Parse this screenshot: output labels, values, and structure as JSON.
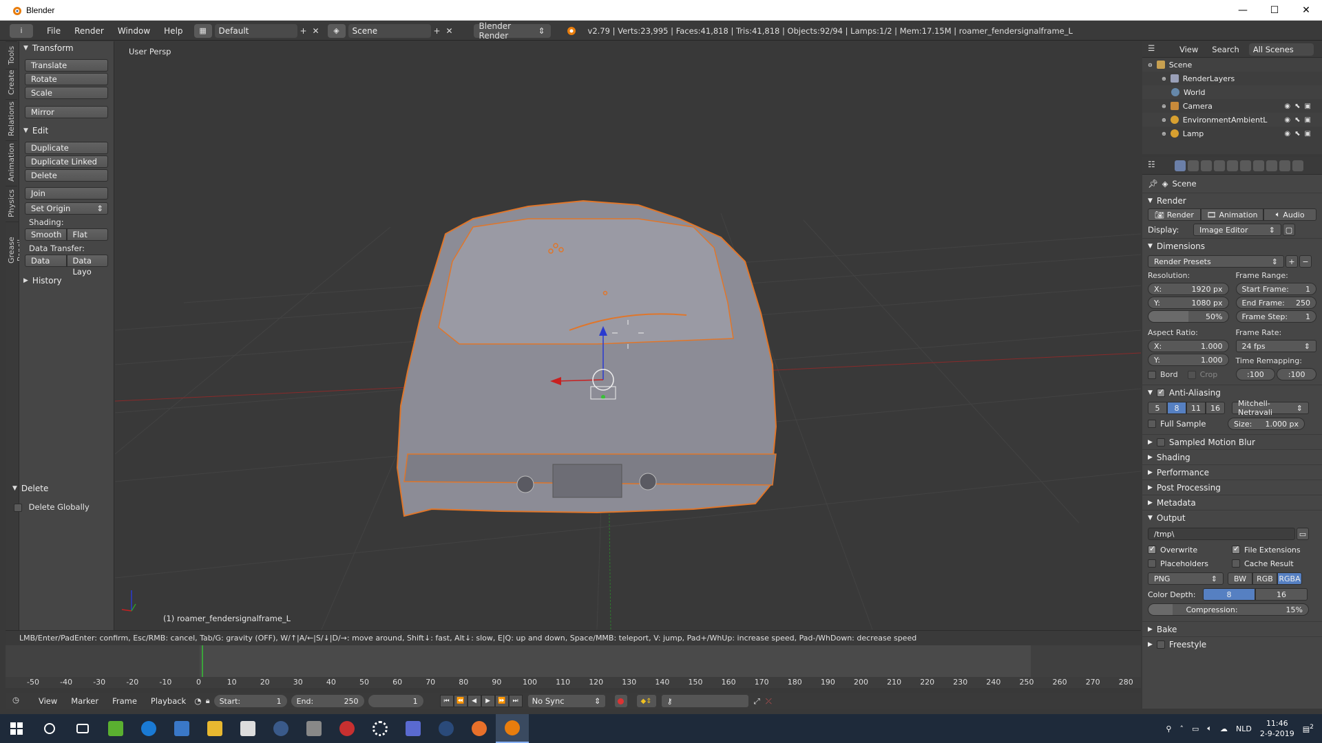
{
  "window": {
    "title": "Blender",
    "minimize": "—",
    "maximize": "☐",
    "close": "✕"
  },
  "info": {
    "editor": "i",
    "menus": [
      "File",
      "Render",
      "Window",
      "Help"
    ],
    "layout": "Default",
    "scene": "Scene",
    "engine": "Blender Render",
    "stats": "v2.79 | Verts:23,995 | Faces:41,818 | Tris:41,818 | Objects:92/94 | Lamps:1/2 | Mem:17.15M | roamer_fendersignalframe_L"
  },
  "tabs": [
    "Tools",
    "Create",
    "Relations",
    "Animation",
    "Physics",
    "Grease Pencil"
  ],
  "tool_shelf": {
    "transform_header": "Transform",
    "translate": "Translate",
    "rotate": "Rotate",
    "scale": "Scale",
    "mirror": "Mirror",
    "edit_header": "Edit",
    "duplicate": "Duplicate",
    "duplicate_linked": "Duplicate Linked",
    "delete": "Delete",
    "join": "Join",
    "set_origin": "Set Origin",
    "shading_label": "Shading:",
    "smooth": "Smooth",
    "flat": "Flat",
    "data_transfer_label": "Data Transfer:",
    "data": "Data",
    "data_layout": "Data Layo",
    "history_header": "History",
    "delete_header": "Delete",
    "delete_globally": "Delete Globally"
  },
  "viewport": {
    "label": "User Persp",
    "object": "(1) roamer_fendersignalframe_L"
  },
  "status": "LMB/Enter/PadEnter: confirm, Esc/RMB: cancel, Tab/G: gravity (OFF), W/↑|A/←|S/↓|D/→: move around, Shift↓: fast, Alt↓: slow, E|Q: up and down, Space/MMB: teleport, V: jump, Pad+/WhUp: increase speed, Pad-/WhDown: decrease speed",
  "timeline": {
    "ticks": [
      -50,
      -40,
      -30,
      -20,
      -10,
      0,
      10,
      20,
      30,
      40,
      50,
      60,
      70,
      80,
      90,
      100,
      110,
      120,
      130,
      140,
      150,
      160,
      170,
      180,
      190,
      200,
      210,
      220,
      230,
      240,
      250,
      260,
      270,
      280
    ],
    "current_frame": 1,
    "menus": [
      "View",
      "Marker",
      "Frame",
      "Playback"
    ],
    "start_label": "Start:",
    "start": "1",
    "end_label": "End:",
    "end": "250",
    "frame": "1",
    "sync": "No Sync"
  },
  "outliner": {
    "view": "View",
    "search": "Search",
    "scenes": "All Scenes",
    "rows": [
      {
        "label": "Scene",
        "color": "#c8a050"
      },
      {
        "label": "RenderLayers",
        "color": "#9aa0b8"
      },
      {
        "label": "World",
        "color": "#6688aa"
      },
      {
        "label": "Camera",
        "color": "#c88a3a"
      },
      {
        "label": "EnvironmentAmbientL",
        "color": "#d8a030"
      },
      {
        "label": "Lamp",
        "color": "#d8a030"
      }
    ]
  },
  "properties": {
    "context": "Scene",
    "render_header": "Render",
    "render_btn": "Render",
    "animation_btn": "Animation",
    "audio_btn": "Audio",
    "display_label": "Display:",
    "display": "Image Editor",
    "dimensions_header": "Dimensions",
    "presets": "Render Presets",
    "resolution_label": "Resolution:",
    "res_x_label": "X:",
    "res_x": "1920 px",
    "res_y_label": "Y:",
    "res_y": "1080 px",
    "res_pct": "50%",
    "frame_range_label": "Frame Range:",
    "start_frame_label": "Start Frame:",
    "start_frame": "1",
    "end_frame_label": "End Frame:",
    "end_frame": "250",
    "frame_step_label": "Frame Step:",
    "frame_step": "1",
    "aspect_label": "Aspect Ratio:",
    "asp_x_label": "X:",
    "asp_x": "1.000",
    "asp_y_label": "Y:",
    "asp_y": "1.000",
    "frame_rate_label": "Frame Rate:",
    "fps": "24 fps",
    "time_remap_label": "Time Remapping:",
    "remap_old": ":100",
    "remap_new": ":100",
    "bord": "Bord",
    "crop": "Crop",
    "aa_header": "Anti-Aliasing",
    "aa_samples": [
      "5",
      "8",
      "11",
      "16"
    ],
    "aa_filter": "Mitchell-Netravali",
    "full_sample": "Full Sample",
    "size_label": "Size:",
    "size": "1.000 px",
    "collapsed": [
      "Sampled Motion Blur",
      "Shading",
      "Performance",
      "Post Processing",
      "Metadata"
    ],
    "output_header": "Output",
    "output_path": "/tmp\\",
    "overwrite": "Overwrite",
    "file_extensions": "File Extensions",
    "placeholders": "Placeholders",
    "cache_result": "Cache Result",
    "format": "PNG",
    "bw": "BW",
    "rgb": "RGB",
    "rgba": "RGBA",
    "color_depth_label": "Color Depth:",
    "depth_8": "8",
    "depth_16": "16",
    "compression_label": "Compression:",
    "compression": "15%",
    "bake": "Bake",
    "freestyle": "Freestyle"
  },
  "taskbar": {
    "lang": "NLD",
    "time": "11:46",
    "date": "2-9-2019",
    "notif_count": "2"
  }
}
